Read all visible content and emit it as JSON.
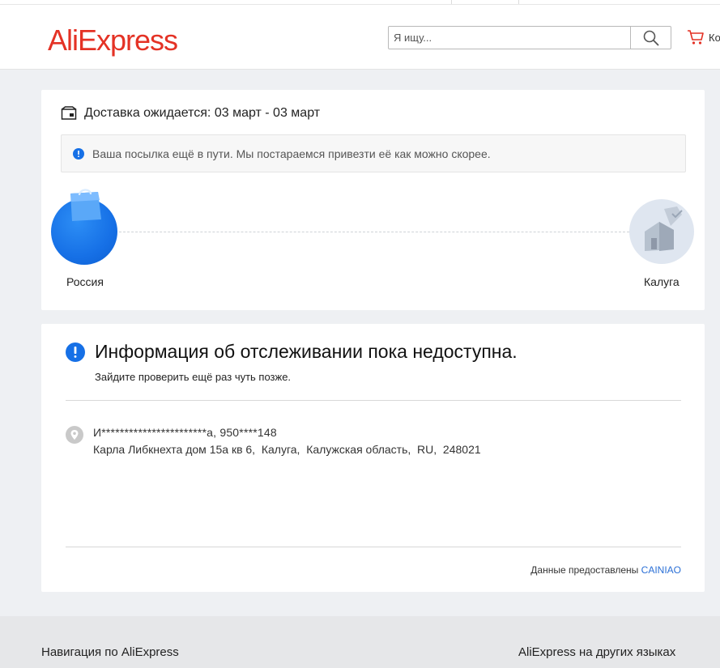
{
  "header": {
    "logo": "AliExpress",
    "search_placeholder": "Я ищу...",
    "cart_label": "Ко"
  },
  "delivery": {
    "expected": "Доставка ожидается: 03 март - 03 март",
    "notice": "Ваша посылка ещё в пути. Мы постараемся привезти её как можно скорее.",
    "route": {
      "from": "Россия",
      "to": "Калуга"
    }
  },
  "tracking": {
    "title": "Информация об отслеживании пока недоступна.",
    "subtitle": "Зайдите проверить ещё раз чуть позже.",
    "recipient": "И***********************а,  950****148",
    "address": "Карла Либкнехта дом 15а кв 6,  Калуга,  Калужская область,  RU,  248021",
    "provided_by_label": "Данные предоставлены",
    "provider": "CAINIAO"
  },
  "footer": {
    "nav": "Навигация по AliExpress",
    "languages": "AliExpress на других языках"
  },
  "colors": {
    "brand": "#e43225",
    "accent_blue": "#1670e6",
    "link": "#2a6fd6"
  }
}
